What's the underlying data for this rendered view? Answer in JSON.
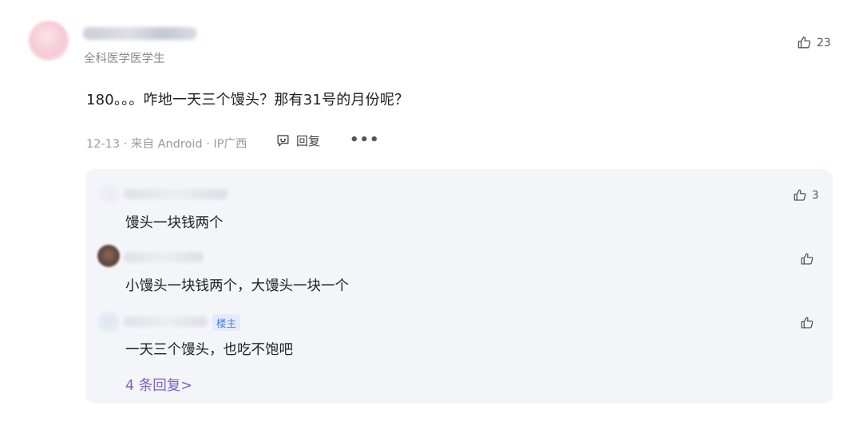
{
  "comment": {
    "user_tag": "全科医学医学生",
    "likes": "23",
    "text": "180。。。咋地一天三个馒头？那有31号的月份呢？",
    "meta": "12-13 · 来自 Android · IP广西",
    "reply_label": "回复",
    "more_label": "•••"
  },
  "replies": [
    {
      "text": "馒头一块钱两个",
      "likes": "3"
    },
    {
      "text": "小馒头一块钱两个，大馒头一块一个",
      "likes": ""
    },
    {
      "text": "一天三个馒头，也吃不饱吧",
      "likes": "",
      "badge": "楼主"
    }
  ],
  "more_replies_label": "4 条回复>"
}
